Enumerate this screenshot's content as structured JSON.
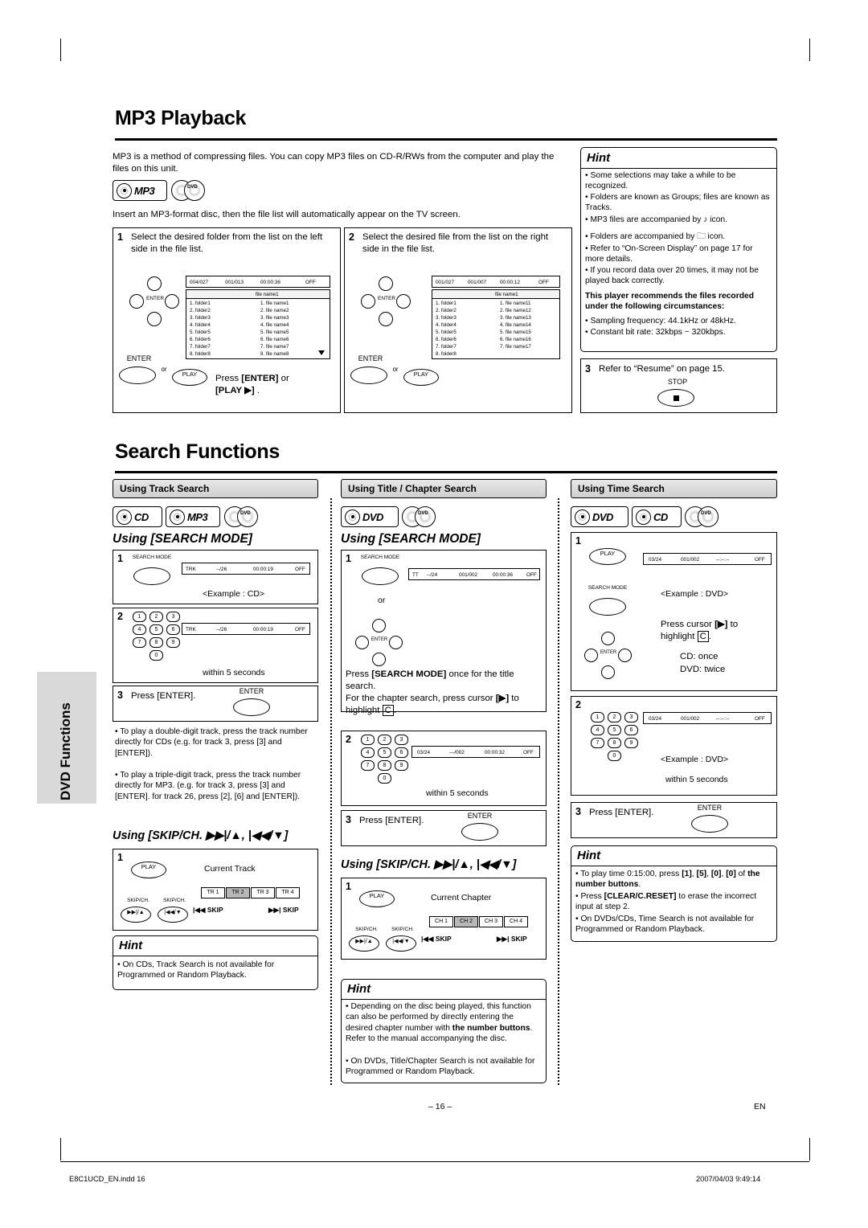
{
  "page": {
    "number": "– 16 –",
    "lang": "EN",
    "footer_left": "E8C1UCD_EN.indd   16",
    "footer_right": "2007/04/03   9:49:14",
    "side_tab": "DVD Functions"
  },
  "mp3": {
    "title": "MP3 Playback",
    "intro": "MP3 is a method of compressing files. You can copy MP3 files on CD-R/RWs from the computer and play the files on this unit.",
    "logos": [
      "MP3",
      "DVD"
    ],
    "insert_line": "Insert an MP3-format disc, then the file list will automatically appear on the TV screen.",
    "steps": [
      {
        "num": "1",
        "text": "Select the desired folder from the list on the left side in the file list.",
        "press": "Press [ENTER] or [PLAY ▶] ."
      },
      {
        "num": "2",
        "text": "Select the desired file from the list on the right side in the file list."
      },
      {
        "num": "3",
        "text": "Refer to “Resume” on page 15."
      }
    ],
    "enter_label": "ENTER",
    "or_label": "or",
    "play_label": "PLAY",
    "stop_label": "STOP",
    "osd_left": [
      "004/027",
      "001/013",
      "00:00:36",
      "OFF"
    ],
    "osd_right": [
      "001/027",
      "001/007",
      "00:00:12",
      "OFF"
    ],
    "file_header": "file name1",
    "folders_left": [
      "1. folder1",
      "2. folder2",
      "3. folder3",
      "4. folder4",
      "5. folder5",
      "6. folder6",
      "7. folder7",
      "8. folder8"
    ],
    "files_left": [
      "1. file name1",
      "2. file name2",
      "3. file name3",
      "4. file name4",
      "5. file name5",
      "6. file name6",
      "7. file name7",
      "8. file name8"
    ],
    "folders_right": [
      "1. folder1",
      "2. folder2",
      "3. folder3",
      "4. folder4",
      "5. folder5",
      "6. folder6",
      "7. folder7",
      "8. folder8"
    ],
    "files_right": [
      "1. file name11",
      "2. file name12",
      "3. file name13",
      "4. file name14",
      "5. file name15",
      "6. file name16",
      "7. file name17"
    ]
  },
  "mp3_hint": {
    "title": "Hint",
    "items": [
      "Some selections may take a while to be recognized.",
      "Folders are known as Groups; files are known as Tracks.",
      "MP3 files are accompanied by ♪ icon.",
      "Folders are accompanied by 🗀 icon.",
      "Refer to “On-Screen Display” on page 17 for more details.",
      "If you record data over 20 times, it may not be played back correctly."
    ],
    "bold_note": "This player recommends the files recorded under the following circumstances:",
    "items2": [
      "Sampling frequency: 44.1kHz or 48kHz.",
      "Constant bit rate: 32kbps ~ 320kbps."
    ]
  },
  "search": {
    "title": "Search Functions"
  },
  "track_search": {
    "head": "Using Track Search",
    "logos": [
      "CD",
      "MP3",
      "DVD"
    ],
    "sub1": "Using [SEARCH MODE]",
    "step1_num": "1",
    "search_mode_label": "SEARCH MODE",
    "osd1": [
      "TRK",
      "--/26",
      "00:00:19",
      "OFF"
    ],
    "example_cd": "<Example : CD>",
    "step2_num": "2",
    "osd2": [
      "TRK",
      "--/26",
      "00:00:19",
      "OFF"
    ],
    "within5": "within 5 seconds",
    "step3_num": "3",
    "step3_text": "Press [ENTER].",
    "enter_label": "ENTER",
    "bullets": [
      "To play a double-digit track, press the track number directly for CDs (e.g. for track 3, press [3] and [ENTER]).",
      "To play a triple-digit track, press the track number directly for MP3. (e.g. for track 3, press [3] and [ENTER]. for track 26, press [2], [6] and [ENTER])."
    ],
    "sub2": "Using [SKIP/CH. ▶▶|/▲, |◀◀/▼]",
    "skip_step": "1",
    "play_label": "PLAY",
    "current_track": "Current Track",
    "tracks": [
      "TR 1",
      "TR 2",
      "TR 3",
      "TR 4"
    ],
    "skip_back": "|◀◀ SKIP",
    "skip_fwd": "▶▶| SKIP",
    "skipch_label": "SKIP/CH.",
    "hint_title": "Hint",
    "hint_items": [
      "On CDs, Track Search is not available for Programmed or Random Playback."
    ]
  },
  "title_chapter_search": {
    "head": "Using Title / Chapter Search",
    "logos": [
      "DVD",
      "DVD"
    ],
    "sub1": "Using [SEARCH MODE]",
    "step1_num": "1",
    "search_mode_label": "SEARCH MODE",
    "osd1": [
      "TT",
      "--/24",
      "001/002",
      "00:00:36",
      "OFF"
    ],
    "or_label": "or",
    "enter_label": "ENTER",
    "text1": "Press [SEARCH MODE] once for the title search.",
    "text2": "For the chapter search, press cursor [▶] to highlight C.",
    "step2_num": "2",
    "osd2": [
      "03/24",
      "---/002",
      "00:00:32",
      "OFF"
    ],
    "within5": "within 5 seconds",
    "step3_num": "3",
    "step3_text": "Press [ENTER].",
    "sub2": "Using [SKIP/CH. ▶▶|/▲, |◀◀/▼]",
    "skip_step": "1",
    "play_label": "PLAY",
    "current_chapter": "Current Chapter",
    "chapters": [
      "CH 1",
      "CH 2",
      "CH 3",
      "CH 4"
    ],
    "skip_back": "|◀◀ SKIP",
    "skip_fwd": "▶▶| SKIP",
    "skipch_label": "SKIP/CH.",
    "hint_title": "Hint",
    "hint_items": [
      "Depending on the disc being played, this function can also be performed by directly entering the desired chapter number with the number buttons. Refer to the manual accompanying the disc.",
      "On DVDs, Title/Chapter Search is not available for Programmed or Random Playback."
    ],
    "hint_bold": "the number buttons"
  },
  "time_search": {
    "head": "Using Time Search",
    "logos": [
      "DVD",
      "CD",
      "DVD"
    ],
    "step1_num": "1",
    "play_label": "PLAY",
    "search_mode_label": "SEARCH MODE",
    "enter_label": "ENTER",
    "osd1": [
      "03/24",
      "001/002",
      "--:--:--",
      "OFF"
    ],
    "example_dvd": "<Example : DVD>",
    "cursor_text": "Press cursor [▶] to highlight C.",
    "cd_once": "CD:      once",
    "dvd_twice": "DVD:   twice",
    "step2_num": "2",
    "osd2": [
      "03/24",
      "001/002",
      "--:--:--",
      "OFF"
    ],
    "example_dvd2": "<Example : DVD>",
    "within5": "within 5 seconds",
    "step3_num": "3",
    "step3_text": "Press [ENTER].",
    "hint_title": "Hint",
    "hint_items": [
      "To play time 0:15:00, press [1], [5], [0], [0] of the number buttons.",
      "Press [CLEAR/C.RESET] to erase the incorrect input at step 2.",
      "On DVDs/CDs, Time Search is not available for Programmed or Random Playback."
    ],
    "hint_bold": "the number buttons"
  },
  "numpad": [
    "1",
    "2",
    "3",
    "4",
    "5",
    "6",
    "7",
    "8",
    "9",
    "0"
  ]
}
